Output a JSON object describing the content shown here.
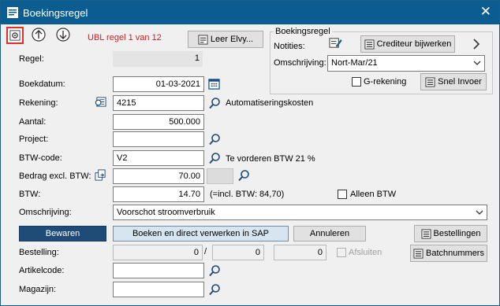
{
  "window": {
    "title": "Boekingsregel"
  },
  "toolbar": {
    "ubl_label": "UBL regel 1 van 12",
    "leer_button": "Leer Elvy..."
  },
  "group_box": {
    "title": "Boekingsregel",
    "notities_label": "Notities:",
    "crediteur_button": "Crediteur bijwerken",
    "omschrijving_label": "Omschrijving:",
    "omschrijving_value": "Nort-Mar/21",
    "g_rekening_label": "G-rekening",
    "snel_invoer_button": "Snel Invoer"
  },
  "form": {
    "regel_label": "Regel:",
    "regel_value": "1",
    "boekdatum_label": "Boekdatum:",
    "boekdatum_value": "01-03-2021",
    "rekening_label": "Rekening:",
    "rekening_value": "4215",
    "rekening_desc": "Automatiseringskosten",
    "aantal_label": "Aantal:",
    "aantal_value": "500.000",
    "project_label": "Project:",
    "project_value": "",
    "btw_code_label": "BTW-code:",
    "btw_code_value": "V2",
    "btw_code_desc": "Te vorderen BTW 21 %",
    "bedrag_label": "Bedrag excl. BTW:",
    "bedrag_value": "70.00",
    "btw_label": "BTW:",
    "btw_value": "14.70",
    "btw_incl": "(=incl. BTW: 84,70)",
    "alleen_btw_label": "Alleen BTW",
    "omschrijving_label": "Omschrijving:",
    "omschrijving_value": "Voorschot stroomverbruik",
    "bestelling_label": "Bestelling:",
    "bestelling_v1": "0",
    "bestelling_sep": "/",
    "bestelling_v2": "0",
    "bestelling_v3": "0",
    "afsluiten_label": "Afsluiten",
    "artikelcode_label": "Artikelcode:",
    "artikelcode_value": "",
    "magazijn_label": "Magazijn:",
    "magazijn_value": ""
  },
  "buttons": {
    "bewaren": "Bewaren",
    "boeken_sap": "Boeken en direct verwerken in SAP",
    "annuleren": "Annuleren",
    "bestellingen": "Bestellingen",
    "batchnummers": "Batchnummers"
  },
  "colors": {
    "titlebar": "#0b5d91",
    "primary_button": "#1f4b78",
    "ubl_text": "#cc1f1f",
    "highlight_border": "#e0302a"
  }
}
